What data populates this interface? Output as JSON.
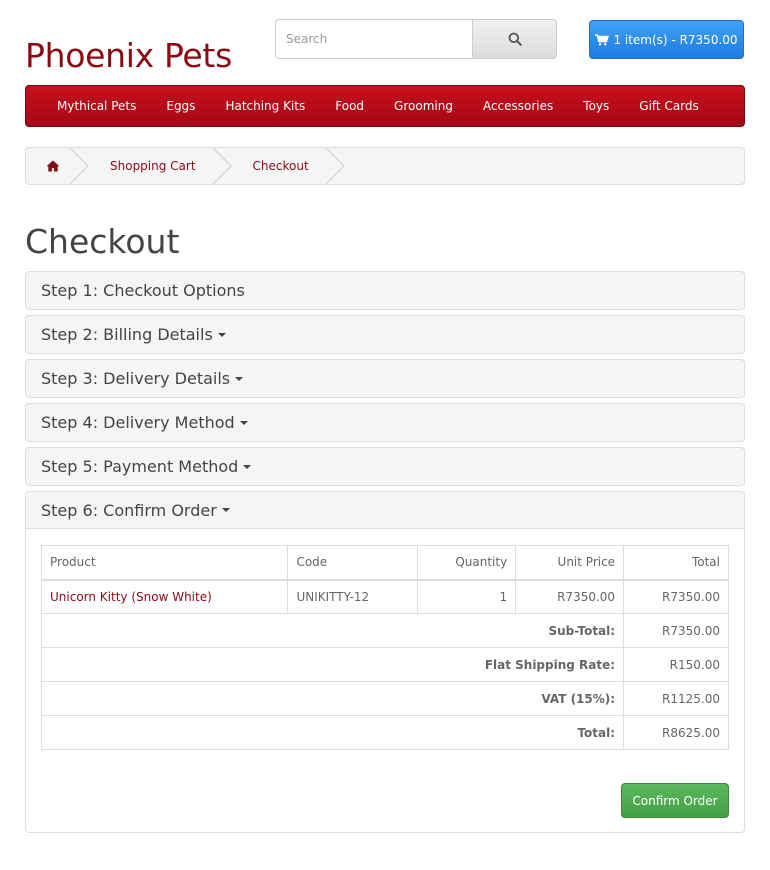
{
  "store": {
    "name": "Phoenix Pets"
  },
  "search": {
    "placeholder": "Search"
  },
  "cart": {
    "label": "1 item(s) - R7350.00"
  },
  "menu": [
    "Mythical Pets",
    "Eggs",
    "Hatching Kits",
    "Food",
    "Grooming",
    "Accessories",
    "Toys",
    "Gift Cards"
  ],
  "breadcrumb": [
    "Shopping Cart",
    "Checkout"
  ],
  "page": {
    "title": "Checkout"
  },
  "steps": [
    "Step 1: Checkout Options",
    "Step 2: Billing Details",
    "Step 3: Delivery Details",
    "Step 4: Delivery Method",
    "Step 5: Payment Method",
    "Step 6: Confirm Order"
  ],
  "order": {
    "headers": [
      "Product",
      "Code",
      "Quantity",
      "Unit Price",
      "Total"
    ],
    "item": {
      "product": "Unicorn Kitty (Snow White)",
      "code": "UNIKITTY-12",
      "quantity": "1",
      "unit_price": "R7350.00",
      "total": "R7350.00"
    },
    "totals": [
      {
        "label": "Sub-Total:",
        "value": "R7350.00"
      },
      {
        "label": "Flat Shipping Rate:",
        "value": "R150.00"
      },
      {
        "label": "VAT (15%):",
        "value": "R1125.00"
      },
      {
        "label": "Total:",
        "value": "R8625.00"
      }
    ],
    "confirm_label": "Confirm Order"
  },
  "colors": {
    "brand": "#8a0a14",
    "menu": "#b70b18",
    "cart_button": "#2a8fe8",
    "confirm_button": "#4cae4c"
  }
}
